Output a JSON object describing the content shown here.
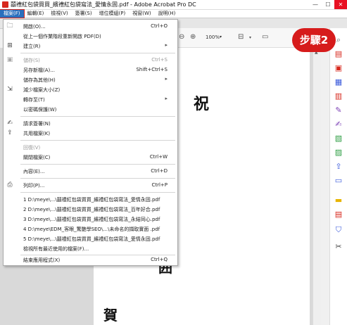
{
  "window": {
    "title": "囍禮紅包袋買買_繽禮紅包袋寫法_愛情永固.pdf - Adobe Acrobat Pro DC",
    "minimize": "—",
    "maximize": "☐",
    "close": "✕"
  },
  "menubar": [
    "檔案(F)",
    "編輯(E)",
    "檢視(V)",
    "簽署(S)",
    "增位模組(P)",
    "視窗(W)",
    "說明(H)"
  ],
  "toolbar": {
    "zoom": "100%"
  },
  "badge": "步驟2",
  "menu": {
    "open": {
      "label": "開啟(O)...",
      "shortcut": "Ctrl+O"
    },
    "reopen": {
      "label": "從上一個作業階段重新開啟 PDF(D)"
    },
    "create": {
      "label": "建立(R)"
    },
    "save": {
      "label": "儲存(S)",
      "shortcut": "Ctrl+S"
    },
    "saveas": {
      "label": "另存新檔(A)...",
      "shortcut": "Shift+Ctrl+S"
    },
    "saveother": {
      "label": "儲存為其他(H)"
    },
    "reduce": {
      "label": "減少檔案大小(Z)"
    },
    "convert": {
      "label": "轉存至(T)"
    },
    "protect": {
      "label": "以密碼保護(W)"
    },
    "request_sign": {
      "label": "請求簽署(N)"
    },
    "share": {
      "label": "共用檔案(K)"
    },
    "revert": {
      "label": "回復(V)"
    },
    "close": {
      "label": "關閉檔案(C)",
      "shortcut": "Ctrl+W"
    },
    "properties": {
      "label": "內容(E)...",
      "shortcut": "Ctrl+D"
    },
    "print": {
      "label": "列印(P)...",
      "shortcut": "Ctrl+P"
    },
    "recent": [
      "1 D:\\meye\\...\\囍禮紅包袋買買_繽禮紅包袋寫法_愛情永固.pdf",
      "2 D:\\meye\\...\\囍禮紅包袋買買_繽禮紅包袋寫法_百年好合.pdf",
      "3 D:\\meye\\...\\囍禮紅包袋買買_繽禮紅包袋寫法_永結同心.pdf",
      "4 D:\\meye\\EDM_客眼_驚艷學SEO\\...\\未命名的擷取實面 .pdf",
      "5 D:\\meye\\...\\囍禮紅包袋買買_繽禮紅包袋寫法_愛情永固.pdf"
    ],
    "view_all": {
      "label": "檢視所有最近使用的檔案(F)..."
    },
    "exit": {
      "label": "結束應用程式(X)",
      "shortcut": "Ctrl+Q"
    }
  },
  "page_text": {
    "char1": "祝",
    "char2": "囲",
    "char3": "賀"
  },
  "colors": {
    "accent": "#d61b1b",
    "menu_highlight": "#2a6fbd"
  }
}
